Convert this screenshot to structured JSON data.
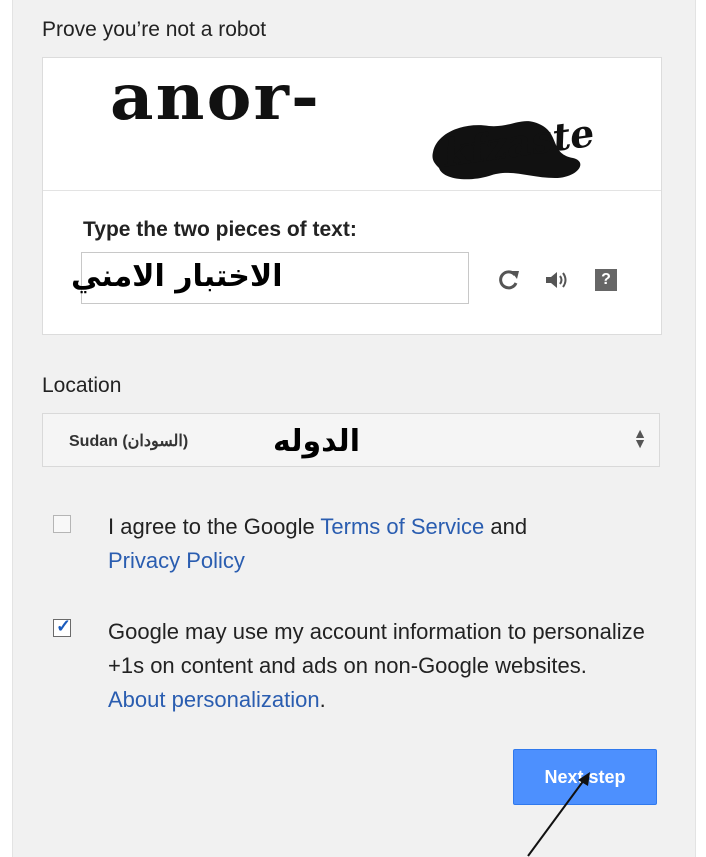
{
  "captcha": {
    "title": "Prove you’re not a robot",
    "image_text_1": "anor-",
    "image_text_2": "kfzaste",
    "instruction": "Type the two pieces of text:",
    "input_value": "الاختبار الامني",
    "icons": [
      "refresh-icon",
      "audio-icon",
      "help-icon"
    ]
  },
  "location": {
    "label": "Location",
    "selected_value": "Sudan (السودان)",
    "overlay_annotation": "الدوله"
  },
  "terms": {
    "checked": false,
    "text_before": "I agree to the Google ",
    "terms_link": "Terms of Service",
    "text_mid": " and",
    "privacy_link": "Privacy Policy"
  },
  "personalization": {
    "checked": true,
    "text": "Google may use my account information to personalize +1s on content and ads on non-Google websites. ",
    "about_link": "About personalization",
    "text_end": "."
  },
  "next_button": {
    "label": "Next step"
  },
  "colors": {
    "panel_bg": "#f1f1f1",
    "link": "#2a5db0",
    "primary_button": "#4d90fe"
  }
}
